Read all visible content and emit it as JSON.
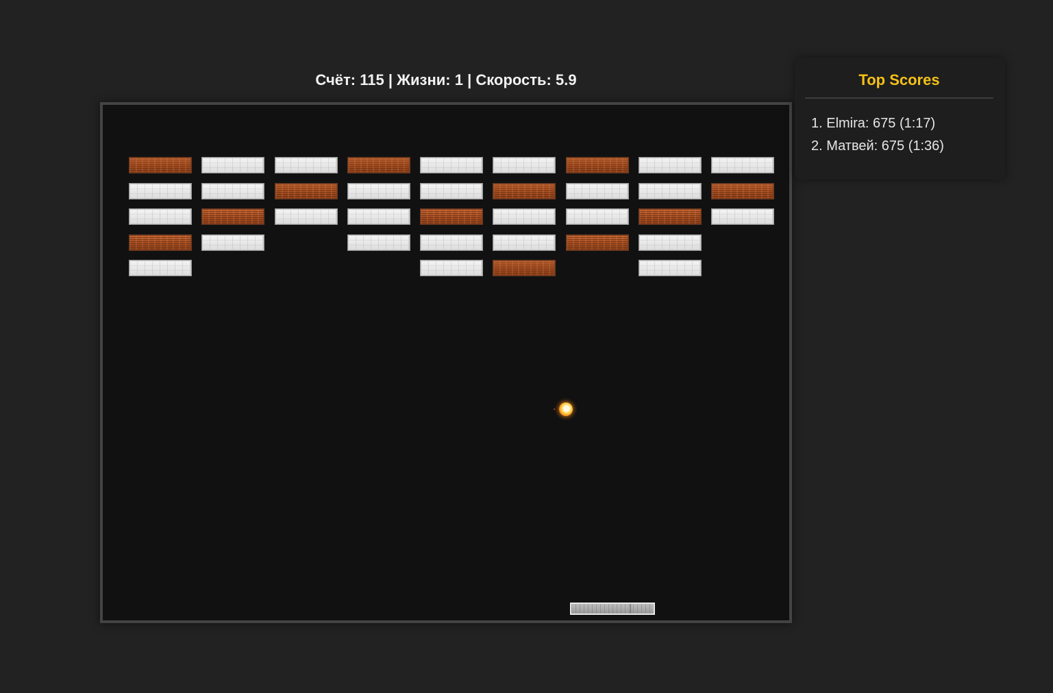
{
  "hud": {
    "score_label": "Счёт:",
    "score": "115",
    "lives_label": "Жизни:",
    "lives": "1",
    "speed_label": "Скорость:",
    "speed": "5.9",
    "separator": "|"
  },
  "bricks": {
    "columns": 9,
    "rows": [
      [
        "wood",
        "stone",
        "stone",
        "wood",
        "stone",
        "stone",
        "wood",
        "stone",
        "stone"
      ],
      [
        "stone",
        "stone",
        "wood",
        "stone",
        "stone",
        "wood",
        "stone",
        "stone",
        "wood"
      ],
      [
        "stone",
        "wood",
        "stone",
        "stone",
        "wood",
        "stone",
        "stone",
        "wood",
        "stone"
      ],
      [
        "wood",
        "stone",
        null,
        "stone",
        "stone",
        "stone",
        "wood",
        "stone",
        null
      ],
      [
        "stone",
        null,
        null,
        null,
        "stone",
        "wood",
        null,
        "stone",
        null
      ]
    ]
  },
  "leaderboard": {
    "title": "Top Scores",
    "entries": [
      "1. Elmira: 675 (1:17)",
      "2. Матвей: 675 (1:36)"
    ]
  },
  "colors": {
    "page_background": "#222222",
    "board_background": "#111111",
    "board_border": "#444444",
    "title_accent": "#f5c118",
    "stone_brick": "#e8e8e8",
    "wood_brick": "#a24a1f"
  }
}
